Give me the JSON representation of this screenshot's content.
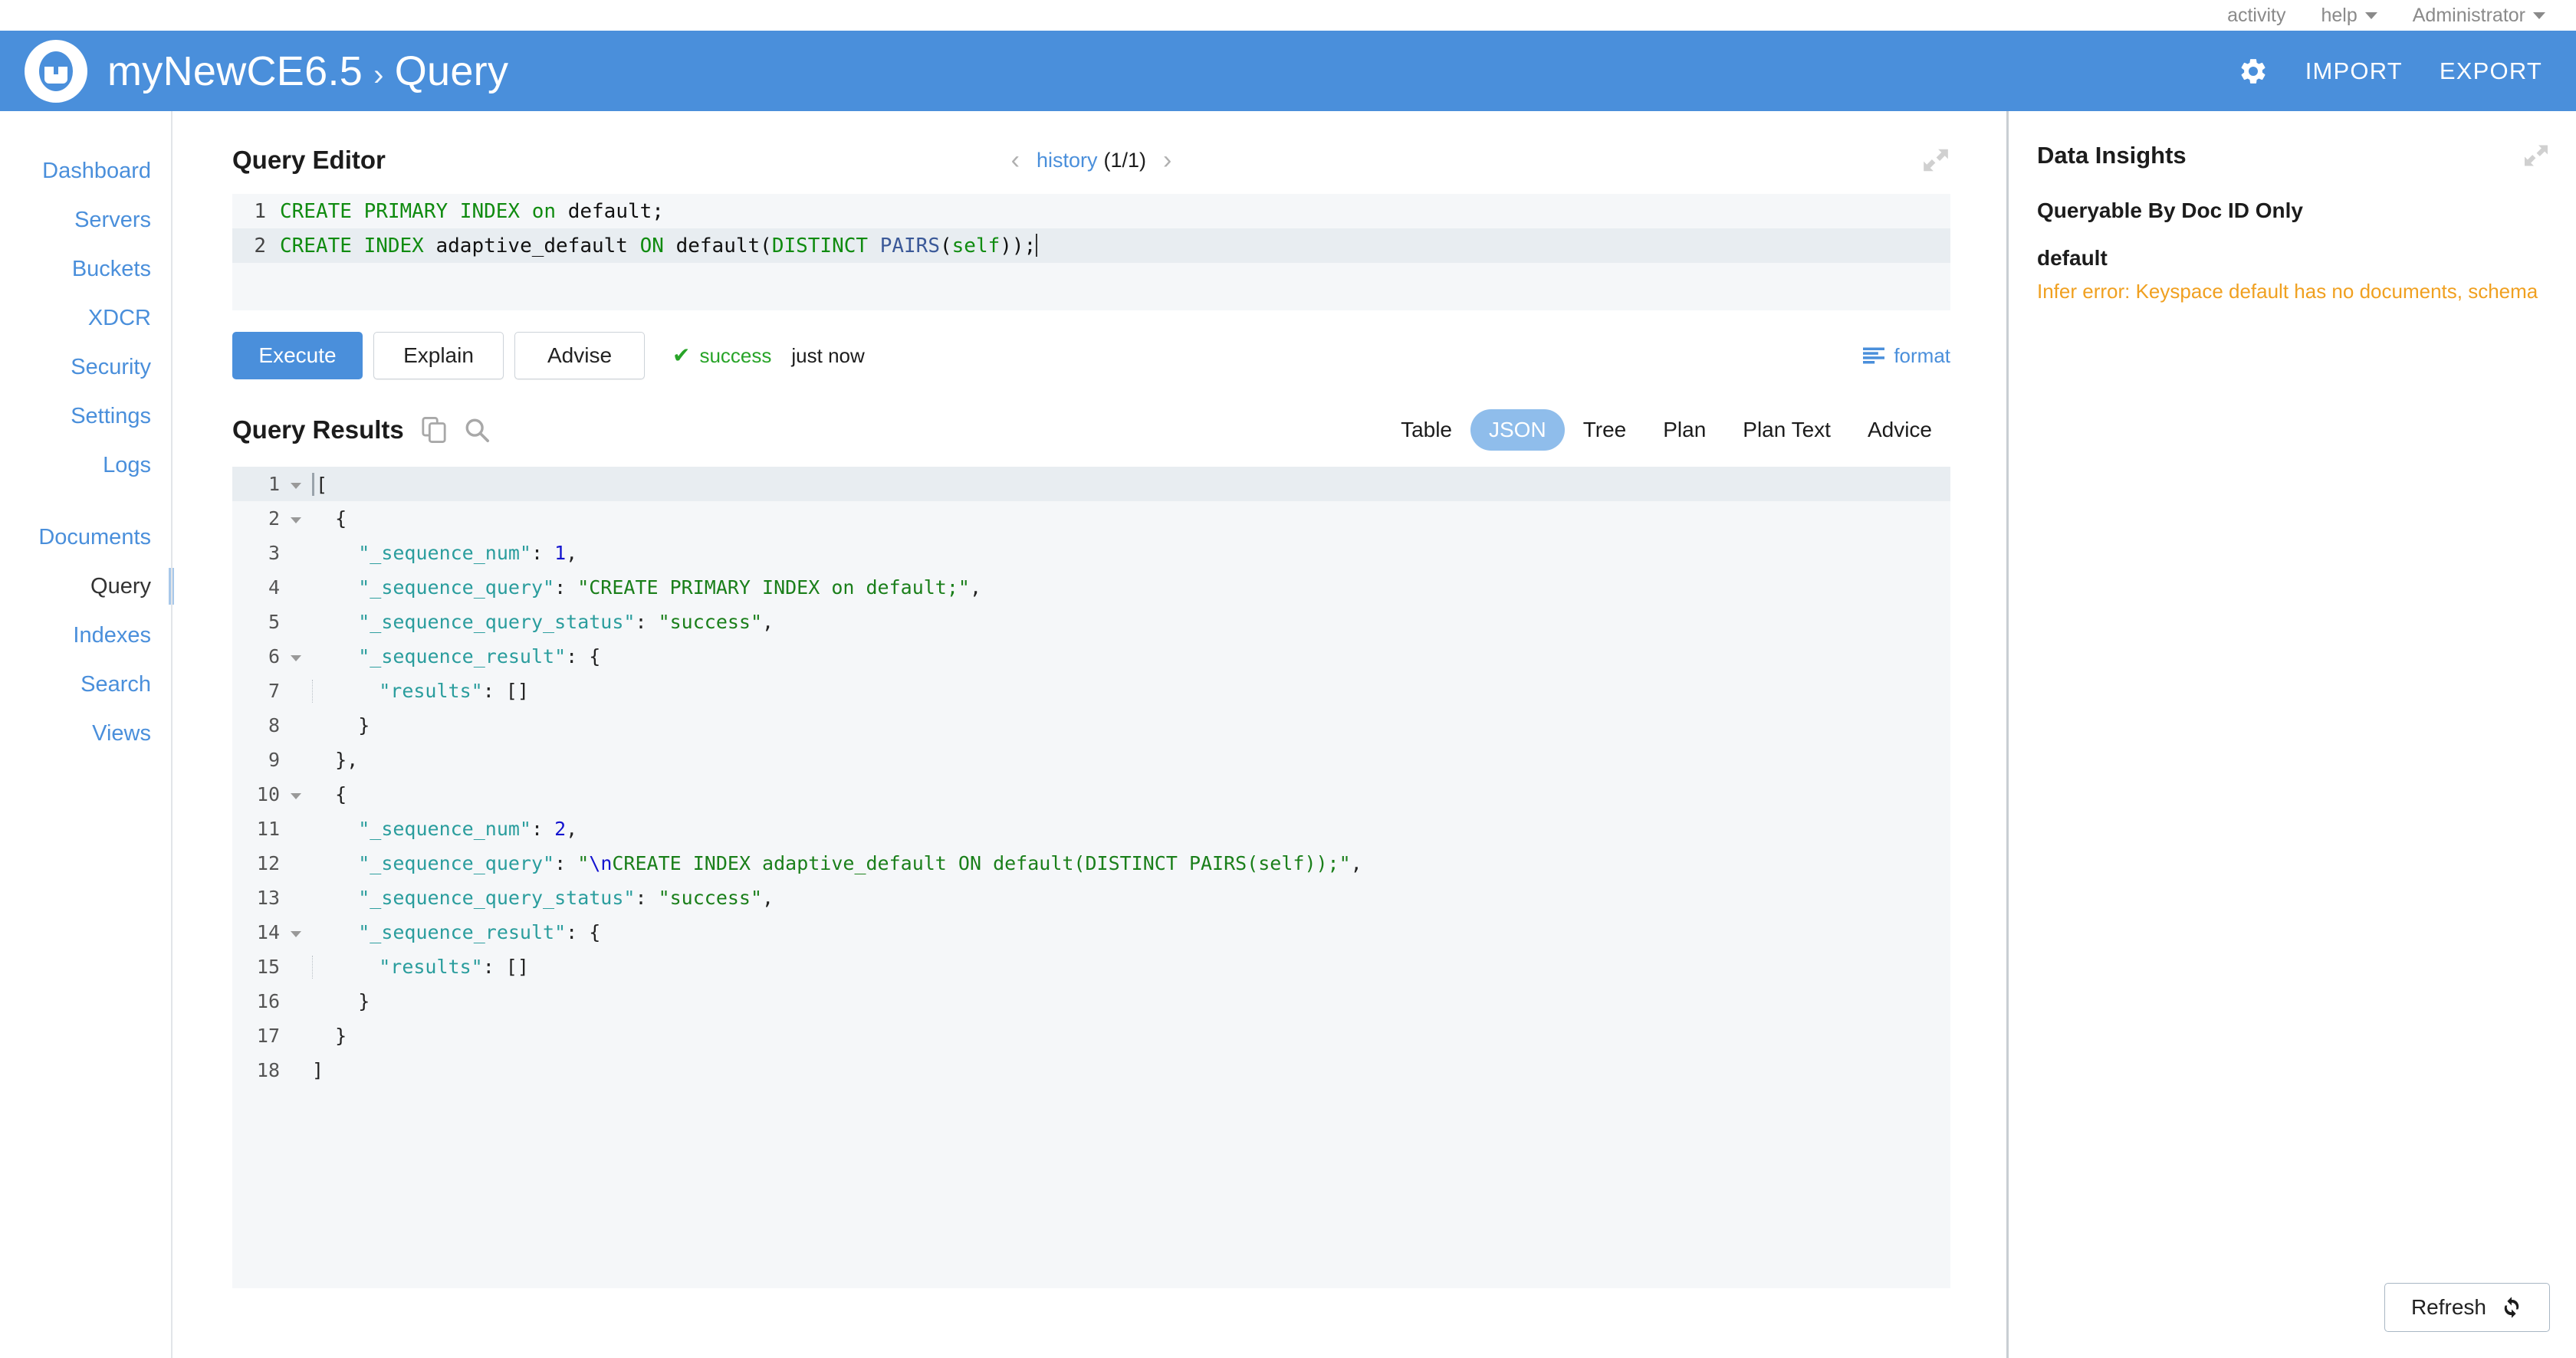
{
  "utility_bar": {
    "activity": "activity",
    "help": "help",
    "account": "Administrator"
  },
  "header": {
    "cluster_name": "myNewCE6.5",
    "separator": "›",
    "page": "Query",
    "gear_title": "settings",
    "import_label": "IMPORT",
    "export_label": "EXPORT"
  },
  "sidebar": {
    "group_one": [
      {
        "label": "Dashboard",
        "active": false
      },
      {
        "label": "Servers",
        "active": false
      },
      {
        "label": "Buckets",
        "active": false
      },
      {
        "label": "XDCR",
        "active": false
      },
      {
        "label": "Security",
        "active": false
      },
      {
        "label": "Settings",
        "active": false
      },
      {
        "label": "Logs",
        "active": false
      }
    ],
    "group_two": [
      {
        "label": "Documents",
        "active": false
      },
      {
        "label": "Query",
        "active": true
      },
      {
        "label": "Indexes",
        "active": false
      },
      {
        "label": "Search",
        "active": false
      },
      {
        "label": "Views",
        "active": false
      }
    ]
  },
  "query_editor": {
    "title": "Query Editor",
    "history_prev": "‹",
    "history_label": "history",
    "history_count": "(1/1)",
    "history_next": "›",
    "lines": [
      {
        "number": "1",
        "active": false,
        "tokens": [
          {
            "t": "CREATE PRIMARY INDEX",
            "c": "kw"
          },
          {
            "t": " on ",
            "c": "kw"
          },
          {
            "t": "default;",
            "c": "id"
          }
        ]
      },
      {
        "number": "2",
        "active": true,
        "tokens": [
          {
            "t": "CREATE INDEX ",
            "c": "kw"
          },
          {
            "t": "adaptive_default ",
            "c": "id"
          },
          {
            "t": "ON ",
            "c": "kw"
          },
          {
            "t": "default(",
            "c": "id"
          },
          {
            "t": "DISTINCT ",
            "c": "kw"
          },
          {
            "t": "PAIRS",
            "c": "fn"
          },
          {
            "t": "(",
            "c": "id"
          },
          {
            "t": "self",
            "c": "kw"
          },
          {
            "t": "));",
            "c": "id"
          }
        ]
      }
    ]
  },
  "actions": {
    "execute": "Execute",
    "explain": "Explain",
    "advise": "Advise",
    "status_icon": "✔",
    "status": "success",
    "status_time": "just now",
    "format": "format"
  },
  "query_results": {
    "title": "Query Results",
    "copy_icon": "copy-icon",
    "search_icon": "search-icon",
    "tabs": [
      {
        "label": "Table",
        "active": false
      },
      {
        "label": "JSON",
        "active": true
      },
      {
        "label": "Tree",
        "active": false
      },
      {
        "label": "Plan",
        "active": false
      },
      {
        "label": "Plan Text",
        "active": false
      },
      {
        "label": "Advice",
        "active": false
      }
    ],
    "json_lines": [
      {
        "number": "1",
        "fold": true,
        "active": true,
        "caret": true,
        "indent": 0,
        "guide": false,
        "tokens": [
          {
            "t": "[",
            "c": "jpun"
          }
        ]
      },
      {
        "number": "2",
        "fold": true,
        "active": false,
        "caret": false,
        "indent": 1,
        "guide": false,
        "tokens": [
          {
            "t": "{",
            "c": "jpun"
          }
        ]
      },
      {
        "number": "3",
        "fold": false,
        "active": false,
        "caret": false,
        "indent": 2,
        "guide": false,
        "tokens": [
          {
            "t": "\"_sequence_num\"",
            "c": "jkey"
          },
          {
            "t": ": ",
            "c": "jpun"
          },
          {
            "t": "1",
            "c": "jnum"
          },
          {
            "t": ",",
            "c": "jpun"
          }
        ]
      },
      {
        "number": "4",
        "fold": false,
        "active": false,
        "caret": false,
        "indent": 2,
        "guide": false,
        "tokens": [
          {
            "t": "\"_sequence_query\"",
            "c": "jkey"
          },
          {
            "t": ": ",
            "c": "jpun"
          },
          {
            "t": "\"CREATE PRIMARY INDEX on default;\"",
            "c": "jstr"
          },
          {
            "t": ",",
            "c": "jpun"
          }
        ]
      },
      {
        "number": "5",
        "fold": false,
        "active": false,
        "caret": false,
        "indent": 2,
        "guide": false,
        "tokens": [
          {
            "t": "\"_sequence_query_status\"",
            "c": "jkey"
          },
          {
            "t": ": ",
            "c": "jpun"
          },
          {
            "t": "\"success\"",
            "c": "jstr"
          },
          {
            "t": ",",
            "c": "jpun"
          }
        ]
      },
      {
        "number": "6",
        "fold": true,
        "active": false,
        "caret": false,
        "indent": 2,
        "guide": false,
        "tokens": [
          {
            "t": "\"_sequence_result\"",
            "c": "jkey"
          },
          {
            "t": ": {",
            "c": "jpun"
          }
        ]
      },
      {
        "number": "7",
        "fold": false,
        "active": false,
        "caret": false,
        "indent": 3,
        "guide": true,
        "tokens": [
          {
            "t": "\"results\"",
            "c": "jkey"
          },
          {
            "t": ": []",
            "c": "jpun"
          }
        ]
      },
      {
        "number": "8",
        "fold": false,
        "active": false,
        "caret": false,
        "indent": 2,
        "guide": false,
        "tokens": [
          {
            "t": "}",
            "c": "jpun"
          }
        ]
      },
      {
        "number": "9",
        "fold": false,
        "active": false,
        "caret": false,
        "indent": 1,
        "guide": false,
        "tokens": [
          {
            "t": "},",
            "c": "jpun"
          }
        ]
      },
      {
        "number": "10",
        "fold": true,
        "active": false,
        "caret": false,
        "indent": 1,
        "guide": false,
        "tokens": [
          {
            "t": "{",
            "c": "jpun"
          }
        ]
      },
      {
        "number": "11",
        "fold": false,
        "active": false,
        "caret": false,
        "indent": 2,
        "guide": false,
        "tokens": [
          {
            "t": "\"_sequence_num\"",
            "c": "jkey"
          },
          {
            "t": ": ",
            "c": "jpun"
          },
          {
            "t": "2",
            "c": "jnum"
          },
          {
            "t": ",",
            "c": "jpun"
          }
        ]
      },
      {
        "number": "12",
        "fold": false,
        "active": false,
        "caret": false,
        "indent": 2,
        "guide": false,
        "tokens": [
          {
            "t": "\"_sequence_query\"",
            "c": "jkey"
          },
          {
            "t": ": ",
            "c": "jpun"
          },
          {
            "t": "\"",
            "c": "jstr"
          },
          {
            "t": "\\n",
            "c": "jesc"
          },
          {
            "t": "CREATE INDEX adaptive_default ON default(DISTINCT PAIRS(self));\"",
            "c": "jstr"
          },
          {
            "t": ",",
            "c": "jpun"
          }
        ]
      },
      {
        "number": "13",
        "fold": false,
        "active": false,
        "caret": false,
        "indent": 2,
        "guide": false,
        "tokens": [
          {
            "t": "\"_sequence_query_status\"",
            "c": "jkey"
          },
          {
            "t": ": ",
            "c": "jpun"
          },
          {
            "t": "\"success\"",
            "c": "jstr"
          },
          {
            "t": ",",
            "c": "jpun"
          }
        ]
      },
      {
        "number": "14",
        "fold": true,
        "active": false,
        "caret": false,
        "indent": 2,
        "guide": false,
        "tokens": [
          {
            "t": "\"_sequence_result\"",
            "c": "jkey"
          },
          {
            "t": ": {",
            "c": "jpun"
          }
        ]
      },
      {
        "number": "15",
        "fold": false,
        "active": false,
        "caret": false,
        "indent": 3,
        "guide": true,
        "tokens": [
          {
            "t": "\"results\"",
            "c": "jkey"
          },
          {
            "t": ": []",
            "c": "jpun"
          }
        ]
      },
      {
        "number": "16",
        "fold": false,
        "active": false,
        "caret": false,
        "indent": 2,
        "guide": false,
        "tokens": [
          {
            "t": "}",
            "c": "jpun"
          }
        ]
      },
      {
        "number": "17",
        "fold": false,
        "active": false,
        "caret": false,
        "indent": 1,
        "guide": false,
        "tokens": [
          {
            "t": "}",
            "c": "jpun"
          }
        ]
      },
      {
        "number": "18",
        "fold": false,
        "active": false,
        "caret": false,
        "indent": 0,
        "guide": false,
        "tokens": [
          {
            "t": "]",
            "c": "jpun"
          }
        ]
      }
    ]
  },
  "data_insights": {
    "title": "Data Insights",
    "subtitle": "Queryable By Doc ID Only",
    "bucket": "default",
    "error": "Infer error: Keyspace default has no documents, schema",
    "refresh": "Refresh"
  },
  "colors": {
    "brand_blue": "#4a8fdb",
    "link_blue": "#4a8fdb",
    "tab_active": "#8fbdeb",
    "success_green": "#28a428",
    "keyword_green": "#108b10",
    "json_key": "#2a9d9d",
    "json_string": "#1a7f1a",
    "json_number": "#1414cf",
    "warning_orange": "#f0a020",
    "panel_bg": "#f5f7f9"
  }
}
